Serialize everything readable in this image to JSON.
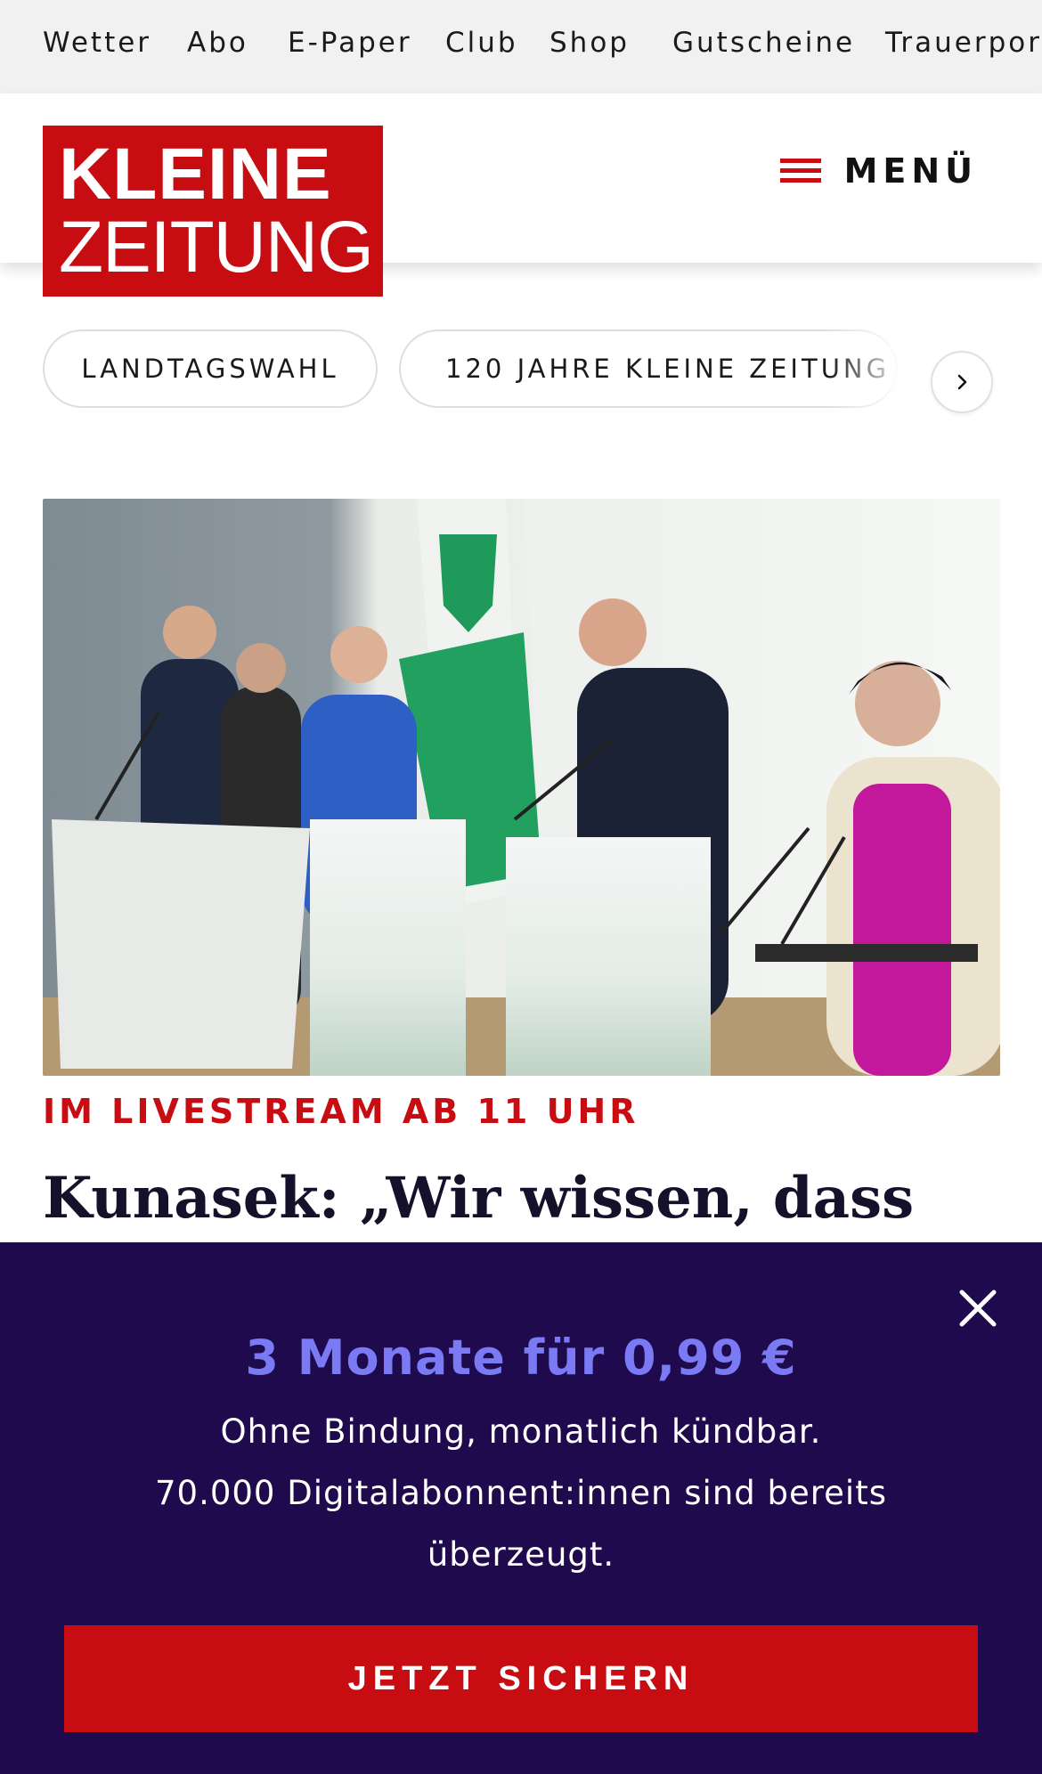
{
  "topnav": {
    "items": [
      "Wetter",
      "Abo",
      "E-Paper",
      "Club",
      "Shop",
      "Gutscheine",
      "Trauerportal"
    ]
  },
  "header": {
    "logo_line1": "KLEINE",
    "logo_line2": "ZEITUNG",
    "menu_label": "MENÜ"
  },
  "topics": {
    "pills": [
      "LANDTAGSWAHL",
      "120 JAHRE KLEINE ZEITUNG"
    ]
  },
  "article": {
    "kicker": "IM LIVESTREAM AB 11 UHR",
    "headline": "Kunasek: „Wir wissen, dass"
  },
  "promo": {
    "title": "3 Monate für 0,99 €",
    "line1": "Ohne Bindung, monatlich kündbar.",
    "line2": "70.000 Digitalabonnent:innen sind bereits überzeugt.",
    "cta": "JETZT SICHERN"
  },
  "colors": {
    "brand_red": "#c70d12",
    "promo_bg": "#1e0a4d",
    "promo_accent": "#7b7af5"
  }
}
